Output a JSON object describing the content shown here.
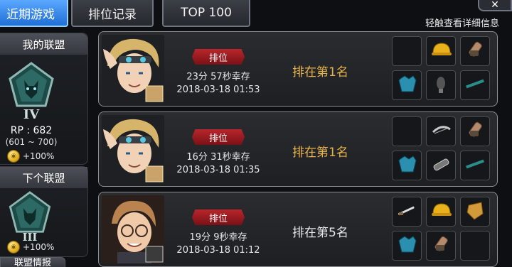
{
  "tabs": [
    {
      "label": "近期游戏",
      "active": true
    },
    {
      "label": "排位记录",
      "active": false
    },
    {
      "label": "TOP 100",
      "active": false
    }
  ],
  "close_icon": "close-x-icon",
  "hint": "轻触查看详细信息",
  "my_league": {
    "title": "我的联盟",
    "tier": "IV",
    "rp": "RP : 682",
    "range": "(601 ~ 700)",
    "bonus": "+100%"
  },
  "next_league": {
    "title": "下个联盟",
    "tier": "III",
    "bonus": "+100%"
  },
  "bottom_tab": "联盟情报",
  "games": [
    {
      "mode": "排位",
      "survive": "23分 57秒幸存",
      "datetime": "2018-03-18 01:53",
      "rank": "排在第1名",
      "rank_color": "#e8b44a",
      "portrait": "character-blonde-goggles",
      "items": [
        "empty",
        "helmet-icon",
        "gauntlet-icon",
        "chest-armor-icon",
        "leg-armor-icon",
        "rifle-icon"
      ]
    },
    {
      "mode": "排位",
      "survive": "16分 31秒幸存",
      "datetime": "2018-03-18 01:35",
      "rank": "排在第1名",
      "rank_color": "#e8b44a",
      "portrait": "character-blonde-goggles",
      "items": [
        "empty",
        "bow-icon",
        "gauntlet-icon",
        "chest-armor-icon",
        "knuckles-icon",
        "rifle-icon"
      ]
    },
    {
      "mode": "排位",
      "survive": "19分 9秒幸存",
      "datetime": "2018-03-18 01:12",
      "rank": "排在第5名",
      "rank_color": "#e6e6e6",
      "portrait": "character-glasses",
      "items": [
        "sword-icon",
        "helmet-icon",
        "shield-icon",
        "chest-armor-icon",
        "gauntlet-icon",
        "empty"
      ]
    }
  ]
}
